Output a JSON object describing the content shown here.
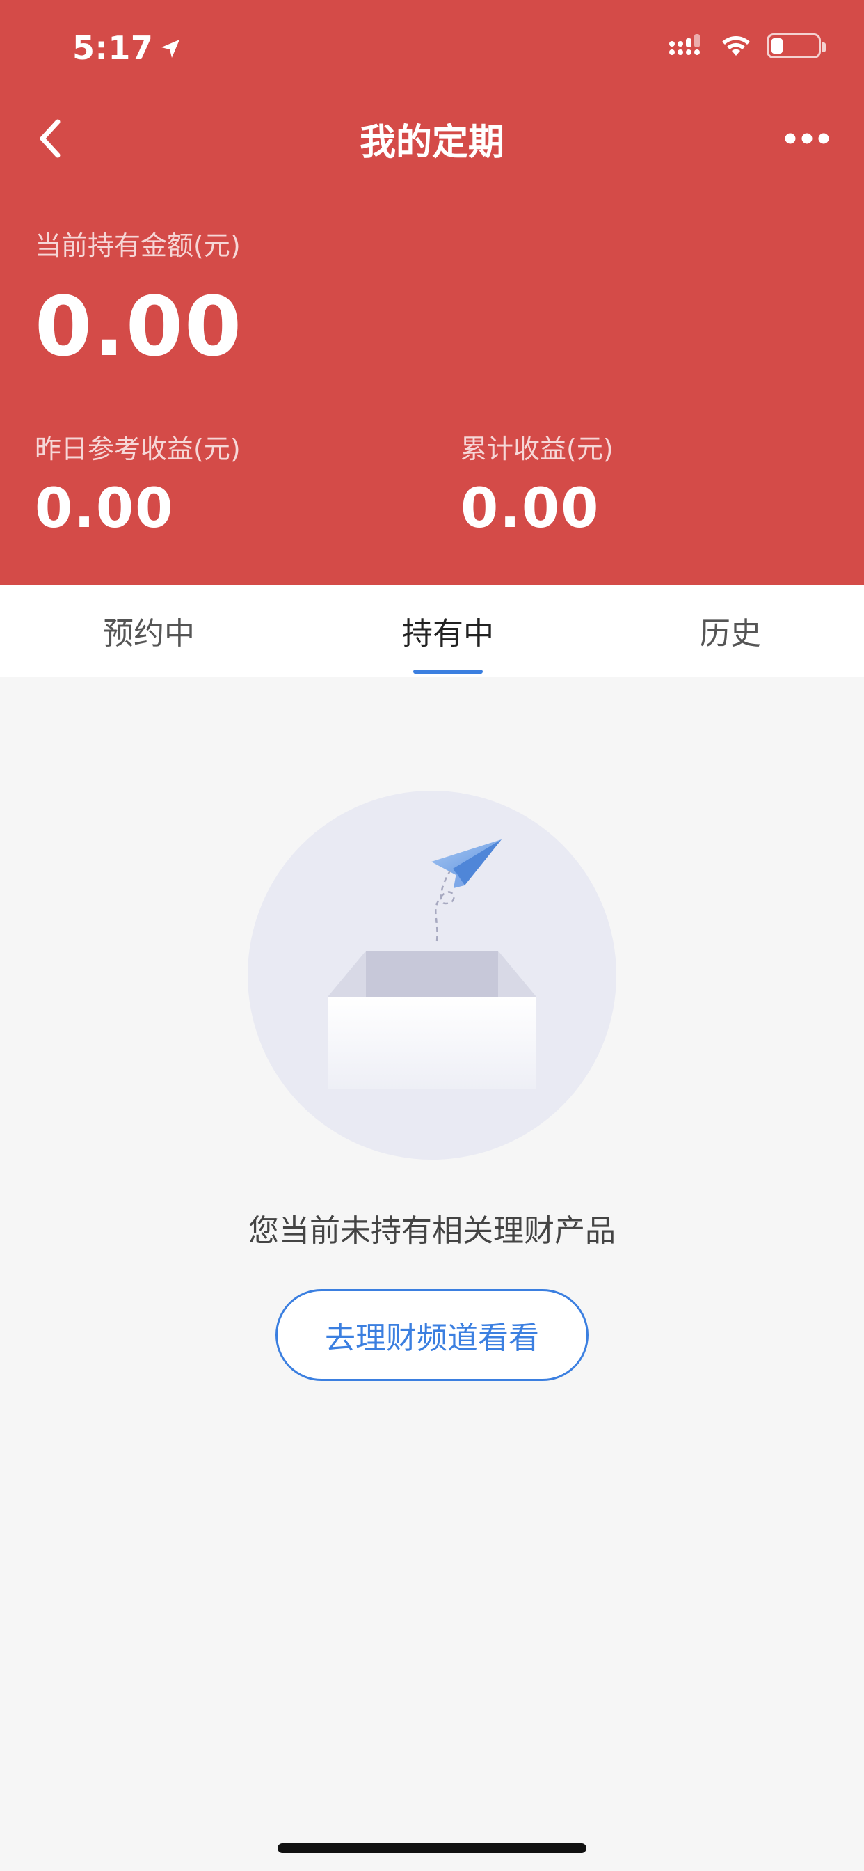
{
  "status_bar": {
    "time": "5:17"
  },
  "nav": {
    "title": "我的定期",
    "back_icon": "chevron-left-icon",
    "more_icon": "more-horizontal-icon"
  },
  "summary": {
    "holding_label": "当前持有金额(元)",
    "holding_amount": "0.00",
    "yesterday_label": "昨日参考收益(元)",
    "yesterday_amount": "0.00",
    "cumulative_label": "累计收益(元)",
    "cumulative_amount": "0.00"
  },
  "tabs": [
    {
      "label": "预约中",
      "active": false
    },
    {
      "label": "持有中",
      "active": true
    },
    {
      "label": "历史",
      "active": false
    }
  ],
  "empty_state": {
    "message": "您当前未持有相关理财产品",
    "button_label": "去理财频道看看"
  },
  "colors": {
    "header_bg": "#d44b48",
    "accent": "#3b7fe0"
  }
}
